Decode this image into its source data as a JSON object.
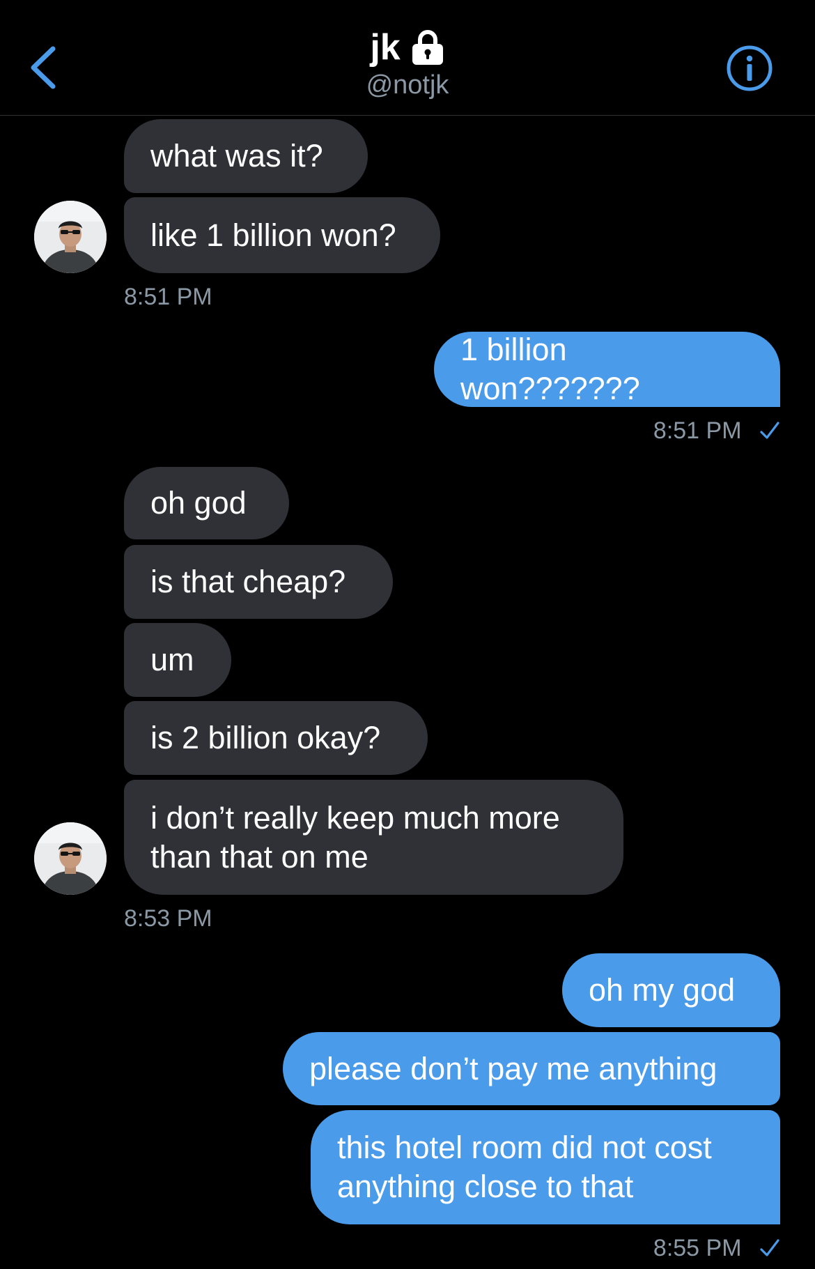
{
  "header": {
    "name": "jk",
    "handle": "@notjk"
  },
  "messages": {
    "m1": "what was it?",
    "m2": "like 1 billion won?",
    "t1": "8:51 PM",
    "m3": "1 billion won???????",
    "t2": "8:51 PM",
    "m4": "oh god",
    "m5": "is that cheap?",
    "m6": "um",
    "m7": "is 2 billion okay?",
    "m8": "i don’t really keep much more\nthan that on me",
    "t3": "8:53 PM",
    "m9": "oh my god",
    "m10": "please don’t pay me anything",
    "m11": "this hotel room did not cost\nanything close to that",
    "t4": "8:55 PM"
  },
  "colors": {
    "accent": "#4a9bea",
    "incoming_bubble": "#2f3136",
    "muted_text": "#8b98a5",
    "background": "#000000"
  },
  "icons": {
    "back": "chevron-left-icon",
    "lock": "lock-icon",
    "info": "info-icon",
    "read_receipt": "checkmark-icon"
  }
}
